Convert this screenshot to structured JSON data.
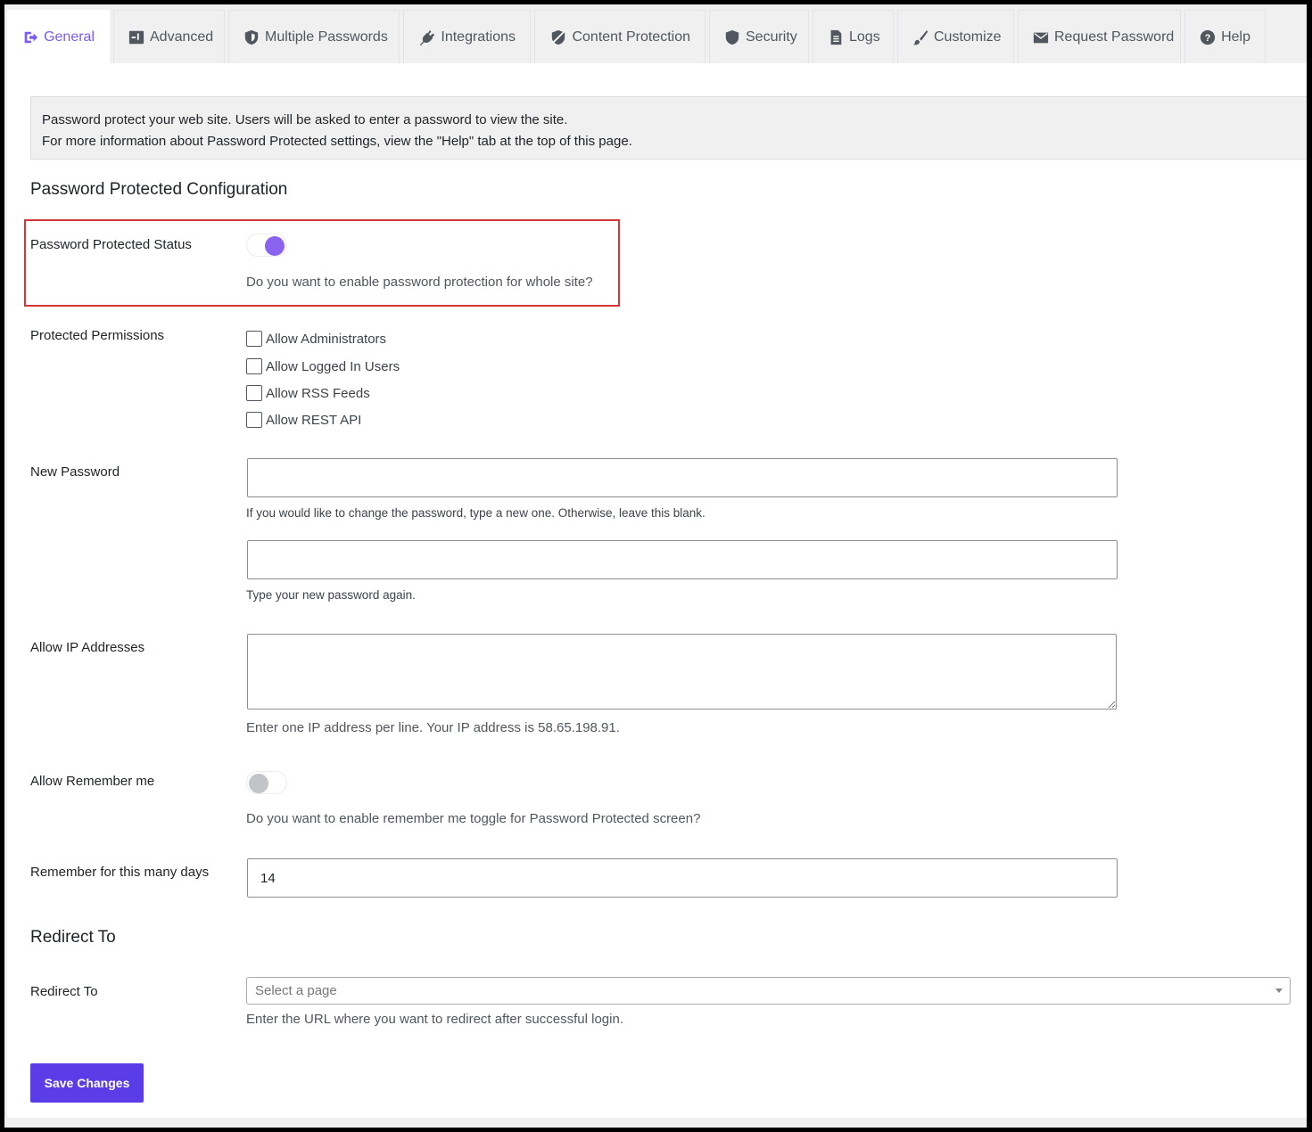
{
  "colors": {
    "accent": "#7b5cf0",
    "toggle_on": "#8a63f1",
    "button": "#5b3de8",
    "highlight_border": "#d63638"
  },
  "tabs": [
    {
      "label": "General",
      "icon": "sign-in-icon",
      "active": true
    },
    {
      "label": "Advanced",
      "icon": "window-icon",
      "active": false
    },
    {
      "label": "Multiple Passwords",
      "icon": "shield-icon",
      "active": false
    },
    {
      "label": "Integrations",
      "icon": "plug-icon",
      "active": false
    },
    {
      "label": "Content Protection",
      "icon": "shield-slash-icon",
      "active": false
    },
    {
      "label": "Security",
      "icon": "shield-icon",
      "active": false
    },
    {
      "label": "Logs",
      "icon": "document-icon",
      "active": false
    },
    {
      "label": "Customize",
      "icon": "brush-icon",
      "active": false
    },
    {
      "label": "Request Password",
      "icon": "envelope-icon",
      "active": false
    },
    {
      "label": "Help",
      "icon": "question-icon",
      "active": false
    }
  ],
  "notice": {
    "line1": "Password protect your web site. Users will be asked to enter a password to view the site.",
    "line2": "For more information about Password Protected settings, view the \"Help\" tab at the top of this page."
  },
  "config": {
    "heading": "Password Protected Configuration",
    "status": {
      "label": "Password Protected Status",
      "enabled": true,
      "description": "Do you want to enable password protection for whole site?"
    },
    "permissions": {
      "label": "Protected Permissions",
      "options": [
        {
          "label": "Allow Administrators",
          "checked": false
        },
        {
          "label": "Allow Logged In Users",
          "checked": false
        },
        {
          "label": "Allow RSS Feeds",
          "checked": false
        },
        {
          "label": "Allow REST API",
          "checked": false
        }
      ]
    },
    "new_password": {
      "label": "New Password",
      "value": "",
      "description": "If you would like to change the password, type a new one. Otherwise, leave this blank.",
      "confirm_value": "",
      "confirm_description": "Type your new password again."
    },
    "ip_addresses": {
      "label": "Allow IP Addresses",
      "value": "",
      "description": "Enter one IP address per line. Your IP address is 58.65.198.91."
    },
    "remember_me": {
      "label": "Allow Remember me",
      "enabled": false,
      "description": "Do you want to enable remember me toggle for Password Protected screen?"
    },
    "remember_days": {
      "label": "Remember for this many days",
      "value": "14"
    }
  },
  "redirect": {
    "heading": "Redirect To",
    "label": "Redirect To",
    "placeholder": "Select a page",
    "description": "Enter the URL where you want to redirect after successful login."
  },
  "save_button": "Save Changes"
}
